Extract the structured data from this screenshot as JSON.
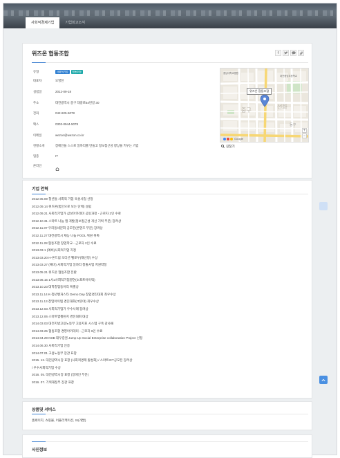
{
  "tabs": [
    {
      "label": "사회적경제기업",
      "active": true
    },
    {
      "label": "기업회고소식",
      "active": false
    }
  ],
  "company": {
    "name": "위즈온 협동조합",
    "share_icons": [
      "facebook-icon",
      "twitter-icon",
      "kakao-icon",
      "link-icon"
    ],
    "info": [
      {
        "key": "유형",
        "value": "",
        "badges": [
          {
            "text": "사회적기업",
            "color": "#2f7fd1"
          },
          {
            "text": "협동조합",
            "color": "#19a7a8"
          }
        ]
      },
      {
        "key": "대표자",
        "value": "오영진"
      },
      {
        "key": "설립일",
        "value": "2012-09-18"
      },
      {
        "key": "주소",
        "value": "대전광역시 중구 대흥로54번길 30"
      },
      {
        "key": "전화",
        "value": "042-825-5078"
      },
      {
        "key": "팩스",
        "value": "0303-0944-5078"
      },
      {
        "key": "이메일",
        "value": "wezon@wezon.co.kr"
      },
      {
        "key": "현황소개",
        "value": "장애인들 스스로 일자리를 만들고 정보접근성 향상을 키우는 기업"
      },
      {
        "key": "업종",
        "value": "IT"
      },
      {
        "key": "온라인",
        "value": ""
      }
    ],
    "map": {
      "marker_label": "위즈온 협동조합",
      "labels": [
        "충남대학교병원",
        "대전중앙초등학교",
        "선화",
        "중구",
        "동구"
      ],
      "google": "Google",
      "link_label": "길찾기"
    }
  },
  "history": {
    "title": "기업 연혁",
    "items": [
      "2012.05.09 청년들 사회적 기업 육성사업 선정",
      "2012.09.14 위즈온(법인으로 보는 단체) 설립",
      "2012.09.21 사회적기업가 삼성아카데미 공동과정 - 근로자 2인 수료",
      "2012.10.31 스마트 나눔 앱 개발(정보접근성 개선 기획 부문) 장려상",
      "2012.11.07 우리동네문화 공모전(콘텐츠 부문) 장려상",
      "2012.11.27 대전광역시 재능 나눔 POOL 위원 위촉",
      "2012.11.28 협동조합 창업학교 - 근로자 2인 수료",
      "2013.03.1 (예비)사회적기업 지정",
      "2013.03.20 H-온드림 오디션 펠로우(재선정) 수상",
      "2013.03.27 (예비) 사회적기업 일자리 창출사업 지원약정",
      "2013.05.21 위즈온 협동조합 전환",
      "2013.06.15 1사1사회적기업결연(소프트아이텍)",
      "2013.10.23 대학창업동아리 특별상",
      "2013.11.14 K-청년벤처스타 Demo Day 창업경진대회 최우수상",
      "2013.11.13 창업아이템 경진대회(IT분야) 최우수상",
      "2013.12.03 사회적기업가 우수사례 장려상",
      "2013.12.06 스마트앱챌린지 경진대회 대상",
      "2014.03.03 대전지방고용노동부 고용지표 시스템 구축 감사패",
      "2014.03.25 협동조합 경영아카데미 - 근로자 6인 수료",
      "2014.04.29 KDB 대우증권 Jump Up Social Enterprise collaboration Project 선정",
      "2014.06.30 사회적기업 인증",
      "2014.07.01 고용노동부 장관 표창",
      "2015. 12. 대전광역시장 표창 (사회적경제 활성화) / 스마트ICT공모전 장려상",
      "/ 우수사회적기업 수상",
      "2016. 05. 대전광역시장 표창 (장애인 부문)",
      "2016. 07. 기획재정부 장관 표창"
    ]
  },
  "products": {
    "title": "상품및 서비스",
    "text": "홈페이지, 쇼핑몰, 어플리케이션, SI(개발)"
  },
  "photos": {
    "title": "사진정보"
  },
  "side_buttons": [
    "scroll-marker-icon",
    "scroll-top-icon"
  ]
}
